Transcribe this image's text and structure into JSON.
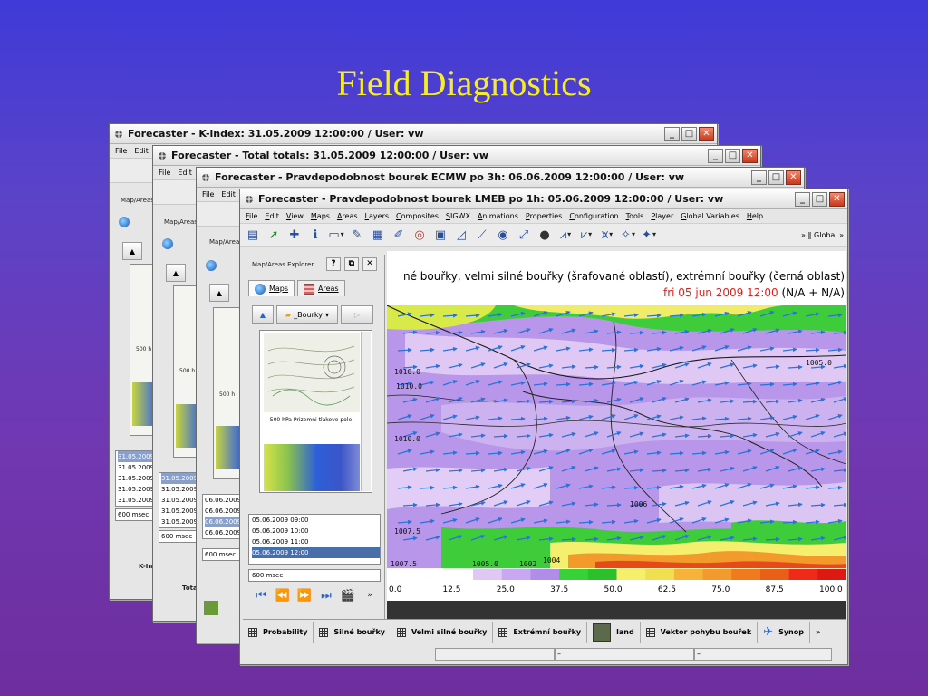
{
  "slide": {
    "title": "Field Diagnostics"
  },
  "windows": [
    {
      "title": "Forecaster - K-index: 31.05.2009 12:00:00 / User: vw",
      "menu": [
        "File",
        "Edit"
      ],
      "panel_label": "Map/Areas",
      "thumb_caption": "500 h",
      "list": [
        "31.05.2009",
        "31.05.2009",
        "31.05.2009",
        "31.05.2009",
        "31.05.2009"
      ],
      "msec": "600 msec",
      "bottom_tab": "K-In"
    },
    {
      "title": "Forecaster - Total totals: 31.05.2009 12:00:00 / User: vw",
      "menu": [
        "File",
        "Edit"
      ],
      "panel_label": "Map/Areas",
      "thumb_caption": "500 h",
      "list": [
        "31.05.2009",
        "31.05.2009",
        "31.05.2009",
        "31.05.2009",
        "31.05.2009"
      ],
      "msec": "600 msec",
      "bottom_tab": "Tota"
    },
    {
      "title": "Forecaster - Pravdepodobnost bourek ECMW po 3h: 06.06.2009 12:00:00 / User: vw",
      "menu": [
        "File",
        "Edit"
      ],
      "panel_label": "Map/Area",
      "thumb_caption": "500 h",
      "list": [
        "06.06.2009",
        "06.06.2009",
        "06.06.2009",
        "06.06.2009"
      ],
      "msec": "600 msec"
    },
    {
      "title": "Forecaster - Pravdepodobnost bourek LMEB po 1h: 05.06.2009 12:00:00 / User: vw",
      "menu": [
        "File",
        "Edit",
        "View",
        "Maps",
        "Areas",
        "Layers",
        "Composites",
        "SIGWX",
        "Animations",
        "Properties",
        "Configuration",
        "Tools",
        "Player",
        "Global Variables",
        "Help"
      ],
      "toolbar_end": "Global",
      "explorer": {
        "title": "Map/Areas Explorer",
        "tab_maps": "Maps",
        "tab_areas": "Areas",
        "folder": "_Bourky",
        "thumb_caption": "500 hPa Prizemni tlakove pole",
        "list": [
          "05.06.2009 09:00",
          "05.06.2009 10:00",
          "05.06.2009 11:00",
          "05.06.2009 12:00"
        ],
        "selected_index": 3,
        "msec": "600 msec"
      },
      "map": {
        "header_line1": "né bouřky, velmi silné bouřky (šrafované oblastí), extrémní bouřky (černá oblast)",
        "header_time": "fri 05 jun 2009 12:00",
        "header_suffix": "(N/A + N/A)",
        "isobar_labels": [
          "1010.0",
          "1010.0",
          "1010.0",
          "1005.0",
          "1006",
          "1007.5",
          "1007.5",
          "1005.0",
          "1002",
          "1004"
        ]
      },
      "bottom_tabs": [
        "Probability",
        "Silné bouřky",
        "Velmi silné bouřky",
        "Extrémní bouřky",
        "land",
        "Vektor pohybu bouřek",
        "Synop"
      ],
      "status": [
        "",
        "–",
        "–"
      ]
    }
  ],
  "colorbar": {
    "ticks": [
      "0.0",
      "12.5",
      "25.0",
      "37.5",
      "50.0",
      "62.5",
      "75.0",
      "87.5",
      "100.0"
    ],
    "colors": [
      "#ffffff",
      "#ffffff",
      "#ffffff",
      "#e0c8f5",
      "#c8a8f0",
      "#b08ee8",
      "#38d238",
      "#2cc02c",
      "#f4f06c",
      "#f0e050",
      "#f5b33a",
      "#f29a2c",
      "#f07a1e",
      "#e86018",
      "#ef2a18",
      "#dc1a12"
    ]
  }
}
